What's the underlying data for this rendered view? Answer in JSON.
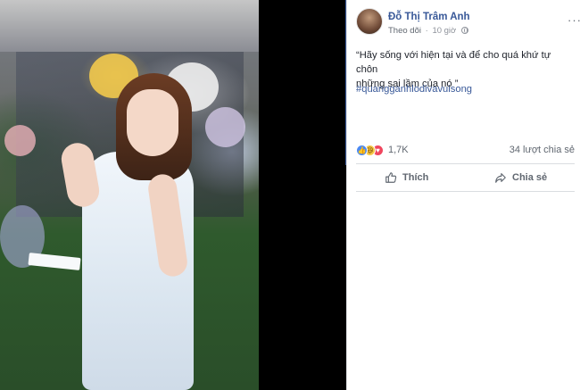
{
  "post": {
    "author": "Đỗ Thị Trâm Anh",
    "follow_label": "Theo dõi",
    "separator": "·",
    "time": "10 giờ",
    "more_label": "···",
    "text_line1": "“Hãy sống với hiện tại và để cho quá khứ tự chôn",
    "text_line2": "những sai lầm của nó ”",
    "hashtag": "#quangganhlodivavuisong",
    "reaction_count": "1,7K",
    "share_count": "34 lượt chia sẻ",
    "like_label": "Thích",
    "share_label": "Chia sẻ",
    "reactions": [
      "like-icon",
      "haha-icon",
      "love-icon"
    ]
  },
  "colors": {
    "link": "#385898",
    "muted": "#90949c",
    "like": "#4a89f3",
    "haha": "#f6c945",
    "love": "#f0465e"
  }
}
